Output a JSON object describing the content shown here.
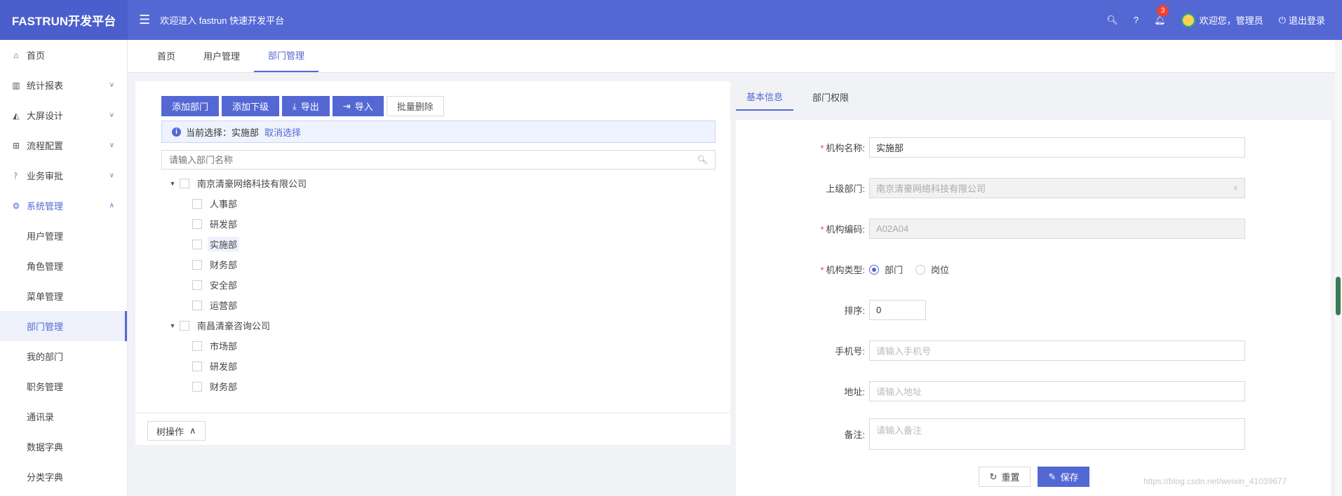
{
  "app": {
    "logo": "FASTRUN开发平台",
    "welcome": "欢迎进入 fastrun 快速开发平台",
    "notification_count": "3",
    "user_greeting": "欢迎您，管理员",
    "logout": "退出登录"
  },
  "sidebar": {
    "items": [
      {
        "label": "首页"
      },
      {
        "label": "统计报表"
      },
      {
        "label": "大屏设计"
      },
      {
        "label": "流程配置"
      },
      {
        "label": "业务审批"
      },
      {
        "label": "系统管理"
      },
      {
        "label": "用户管理"
      },
      {
        "label": "角色管理"
      },
      {
        "label": "菜单管理"
      },
      {
        "label": "部门管理"
      },
      {
        "label": "我的部门"
      },
      {
        "label": "职务管理"
      },
      {
        "label": "通讯录"
      },
      {
        "label": "数据字典"
      },
      {
        "label": "分类字典"
      }
    ]
  },
  "tabs": [
    {
      "label": "首页"
    },
    {
      "label": "用户管理"
    },
    {
      "label": "部门管理"
    }
  ],
  "toolbar": {
    "add_dept": "添加部门",
    "add_child": "添加下级",
    "export": "导出",
    "import": "导入",
    "batch_delete": "批量删除"
  },
  "alert": {
    "prefix": "当前选择：",
    "selected": "实施部",
    "cancel": "取消选择"
  },
  "tree_search": {
    "placeholder": "请输入部门名称"
  },
  "tree": [
    {
      "label": "南京清豪网络科技有限公司",
      "children": [
        "人事部",
        "研发部",
        "实施部",
        "财务部",
        "安全部",
        "运营部"
      ]
    },
    {
      "label": "南昌清豪咨询公司",
      "children": [
        "市场部",
        "研发部",
        "财务部"
      ]
    }
  ],
  "tree_op": "树操作",
  "right_tabs": [
    {
      "label": "基本信息"
    },
    {
      "label": "部门权限"
    }
  ],
  "form": {
    "name_label": "机构名称:",
    "name_value": "实施部",
    "parent_label": "上级部门:",
    "parent_value": "南京清豪网络科技有限公司",
    "code_label": "机构编码:",
    "code_value": "A02A04",
    "type_label": "机构类型:",
    "type_options": [
      "部门",
      "岗位"
    ],
    "type_selected": "部门",
    "order_label": "排序:",
    "order_value": "0",
    "phone_label": "手机号:",
    "phone_placeholder": "请输入手机号",
    "address_label": "地址:",
    "address_placeholder": "请输入地址",
    "remark_label": "备注:",
    "remark_placeholder": "请输入备注",
    "reset": "重置",
    "save": "保存"
  },
  "watermark": "https://blog.csdn.net/weixin_41039677",
  "colors": {
    "primary": "#5468d4",
    "header": "#5468d4",
    "danger": "#f04134"
  }
}
